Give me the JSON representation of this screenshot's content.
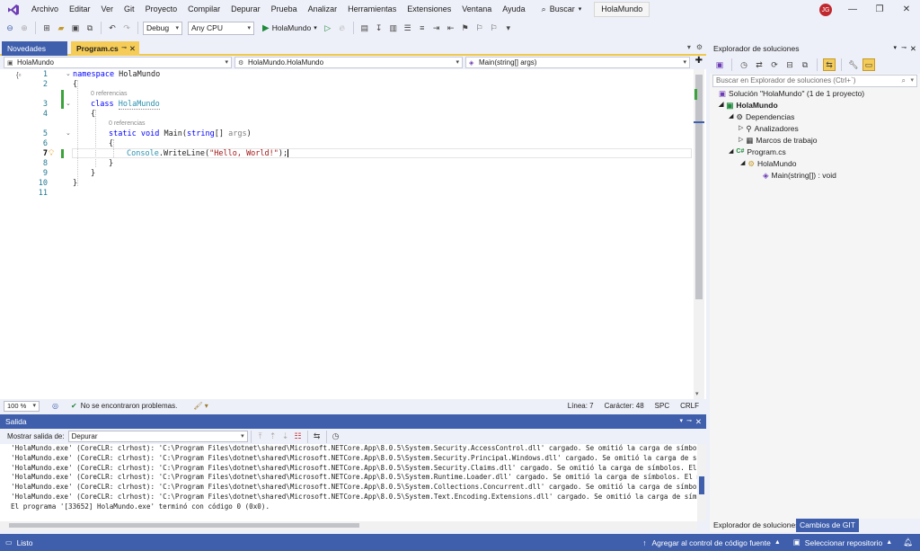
{
  "app": {
    "menu": [
      "Archivo",
      "Editar",
      "Ver",
      "Git",
      "Proyecto",
      "Compilar",
      "Depurar",
      "Prueba",
      "Analizar",
      "Herramientas",
      "Extensiones",
      "Ventana",
      "Ayuda"
    ],
    "search_label": "Buscar",
    "solution_name": "HolaMundo",
    "user_initials": "JG"
  },
  "toolbar": {
    "config": "Debug",
    "platform": "Any CPU",
    "run_label": "HolaMundo"
  },
  "tabs": {
    "novedades": "Novedades",
    "program": "Program.cs"
  },
  "navbar": {
    "project": "HolaMundo",
    "type": "HolaMundo.HolaMundo",
    "member": "Main(string[] args)"
  },
  "editor": {
    "line_numbers": [
      "1",
      "2",
      "3",
      "4",
      "5",
      "6",
      "7",
      "8",
      "9",
      "10",
      "11"
    ],
    "refs0": "0 referencias",
    "refs1": "0 referencias",
    "kw_namespace": "namespace",
    "ns_name": " HolaMundo",
    "brace_open": "{",
    "brace_close": "}",
    "kw_class": "class",
    "class_name": "HolaMundo",
    "kw_static": "static",
    "kw_void": "void",
    "method": " Main(",
    "kw_string": "string",
    "params": "[] ",
    "param_name": "args",
    "paren_close": ")",
    "console": "Console",
    "writeline": ".WriteLine(",
    "str_literal": "\"Hello, World!\"",
    "stmt_end": ");"
  },
  "editor_status": {
    "zoom": "100 %",
    "issues": "No se encontraron problemas.",
    "line": "Línea: 7",
    "char": "Carácter: 48",
    "spc": "SPC",
    "crlf": "CRLF"
  },
  "output": {
    "title": "Salida",
    "show_from_label": "Mostrar salida de:",
    "source": "Depurar",
    "lines": [
      "'HolaMundo.exe' (CoreCLR: clrhost): 'C:\\Program Files\\dotnet\\shared\\Microsoft.NETCore.App\\8.0.5\\System.Security.AccessControl.dll' cargado. Se omitió la carga de símbolos. El mód",
      "'HolaMundo.exe' (CoreCLR: clrhost): 'C:\\Program Files\\dotnet\\shared\\Microsoft.NETCore.App\\8.0.5\\System.Security.Principal.Windows.dll' cargado. Se omitió la carga de símbolos. El",
      "'HolaMundo.exe' (CoreCLR: clrhost): 'C:\\Program Files\\dotnet\\shared\\Microsoft.NETCore.App\\8.0.5\\System.Security.Claims.dll' cargado. Se omitió la carga de símbolos. El módulo est",
      "'HolaMundo.exe' (CoreCLR: clrhost): 'C:\\Program Files\\dotnet\\shared\\Microsoft.NETCore.App\\8.0.5\\System.Runtime.Loader.dll' cargado. Se omitió la carga de símbolos. El módulo está",
      "'HolaMundo.exe' (CoreCLR: clrhost): 'C:\\Program Files\\dotnet\\shared\\Microsoft.NETCore.App\\8.0.5\\System.Collections.Concurrent.dll' cargado. Se omitió la carga de símbolos. El mó",
      "'HolaMundo.exe' (CoreCLR: clrhost): 'C:\\Program Files\\dotnet\\shared\\Microsoft.NETCore.App\\8.0.5\\System.Text.Encoding.Extensions.dll' cargado. Se omitió la carga de símbolos. El m",
      "El programa '[33652] HolaMundo.exe' terminó con código 0 (0x0)."
    ]
  },
  "solution_explorer": {
    "title": "Explorador de soluciones",
    "search_placeholder": "Buscar en Explorador de soluciones (Ctrl+`)",
    "solution": "Solución \"HolaMundo\" (1 de 1 proyecto)",
    "project": "HolaMundo",
    "dependencias": "Dependencias",
    "analizadores": "Analizadores",
    "marcos": "Marcos de trabajo",
    "program_file": "Program.cs",
    "class_node": "HolaMundo",
    "method_node": "Main(string[]) : void",
    "tab_explorer": "Explorador de soluciones",
    "tab_git": "Cambios de GIT"
  },
  "status": {
    "ready": "Listo",
    "source_control": "Agregar al control de código fuente",
    "repo": "Seleccionar repositorio"
  },
  "colors": {
    "accent": "#3f5fad",
    "tab_active": "#f5cc57",
    "keyword": "#0000ff",
    "type": "#2b91af",
    "string": "#a31515"
  }
}
